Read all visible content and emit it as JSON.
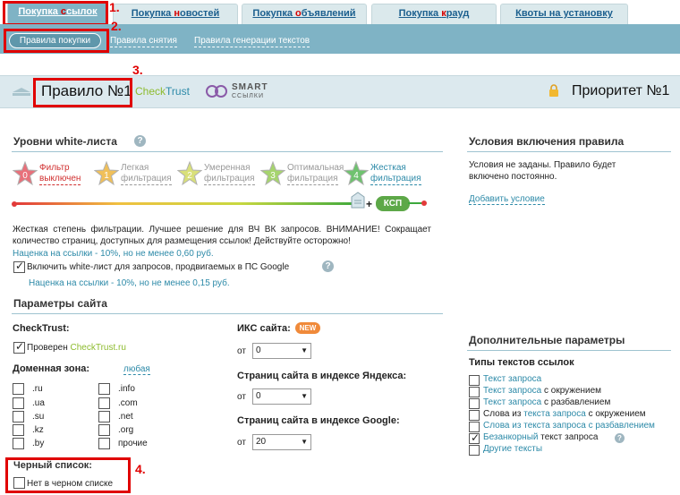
{
  "tabs": [
    {
      "label_pre": "Покупка ",
      "label_red": "с",
      "label_post": "сылок"
    },
    {
      "label_pre": "Покупка ",
      "label_red": "н",
      "label_post": "овостей"
    },
    {
      "label_pre": "Покупка ",
      "label_red": "о",
      "label_post": "бъявлений"
    },
    {
      "label_pre": "Покупка ",
      "label_red": "к",
      "label_post": "рауд"
    },
    {
      "label_pre": "Квоты на установку",
      "label_red": "",
      "label_post": ""
    }
  ],
  "subnav": [
    "Правила покупки",
    "Правила снятия",
    "Правила генерации текстов"
  ],
  "markers": [
    "1.",
    "2.",
    "3.",
    "4."
  ],
  "rule": {
    "title": "Правило №1",
    "checktrust_a": "Check",
    "checktrust_b": "Trust",
    "smart_a": "SMART",
    "smart_b": "ССЫЛКИ",
    "priority": "Приоритет №1"
  },
  "whitelist": {
    "title": "Уровни white-листа",
    "levels": [
      {
        "num": "0",
        "line1": "Фильтр",
        "line2": "выключен",
        "color": "#e8707a"
      },
      {
        "num": "1",
        "line1": "Легкая",
        "line2": "фильтрация",
        "color": "#f0c05a"
      },
      {
        "num": "2",
        "line1": "Умеренная",
        "line2": "фильтрация",
        "color": "#d9e07a"
      },
      {
        "num": "3",
        "line1": "Оптимальная",
        "line2": "фильтрация",
        "color": "#a6d46e"
      },
      {
        "num": "4",
        "line1": "Жесткая",
        "line2": "фильтрация",
        "color": "#6fc26f"
      }
    ],
    "ksp_label": "КСП",
    "plus": "+",
    "description": "Жесткая степень фильтрации. Лучшее решение для ВЧ ВК запросов. ВНИМАНИЕ! Сокращает количество страниц, доступных для размещения ссылок! Действуйте осторожно!",
    "markup1": "Наценка на ссылки - 10%, но не менее 0,60 руб.",
    "google_checkbox": "Включить white-лист для запросов, продвигаемых в ПС Google",
    "markup2": "Наценка на ссылки - 10%, но не менее 0,15 руб."
  },
  "conditions": {
    "title": "Условия включения правила",
    "text": "Условия не заданы. Правило будет включено постоянно.",
    "add_link": "Добавить условие"
  },
  "site_params": {
    "title": "Параметры сайта",
    "checktrust_label": "CheckTrust:",
    "verified_pre": "Проверен ",
    "verified_link": "CheckTrust.ru",
    "domain_label": "Доменная зона:",
    "any_link": "любая",
    "zones_left": [
      ".ru",
      ".ua",
      ".su",
      ".kz",
      ".by"
    ],
    "zones_right": [
      ".info",
      ".com",
      ".net",
      ".org",
      "прочие"
    ],
    "blacklist_label": "Черный список:",
    "blacklist_checkbox": "Нет в черном списке",
    "iks_label": "ИКС сайта:",
    "new_badge": "NEW",
    "from": "от",
    "iks_value": "0",
    "yandex_label": "Страниц сайта в индексе Яндекса:",
    "yandex_value": "0",
    "google_label": "Страниц сайта в индексе Google:",
    "google_value": "20"
  },
  "extra": {
    "title": "Дополнительные параметры",
    "types_label": "Типы текстов ссылок",
    "types": [
      {
        "parts": [
          [
            "Текст запроса",
            "link"
          ]
        ],
        "checked": false
      },
      {
        "parts": [
          [
            "Текст запроса",
            "link"
          ],
          [
            " с окружением",
            "plain"
          ]
        ],
        "checked": false
      },
      {
        "parts": [
          [
            "Текст запроса",
            "link"
          ],
          [
            " с разбавлением",
            "plain"
          ]
        ],
        "checked": false
      },
      {
        "parts": [
          [
            "Слова из ",
            "plain"
          ],
          [
            "текста запроса",
            "link"
          ],
          [
            " с окружением",
            "plain"
          ]
        ],
        "checked": false
      },
      {
        "parts": [
          [
            "Слова из ",
            "link"
          ],
          [
            "текста запроса",
            "link"
          ],
          [
            " с разбавлением",
            "link"
          ]
        ],
        "checked": false
      },
      {
        "parts": [
          [
            "Безанкорный",
            "link"
          ],
          [
            " текст запроса",
            "plain"
          ]
        ],
        "checked": true
      },
      {
        "parts": [
          [
            "Другие тексты",
            "link"
          ]
        ],
        "checked": false
      }
    ]
  }
}
